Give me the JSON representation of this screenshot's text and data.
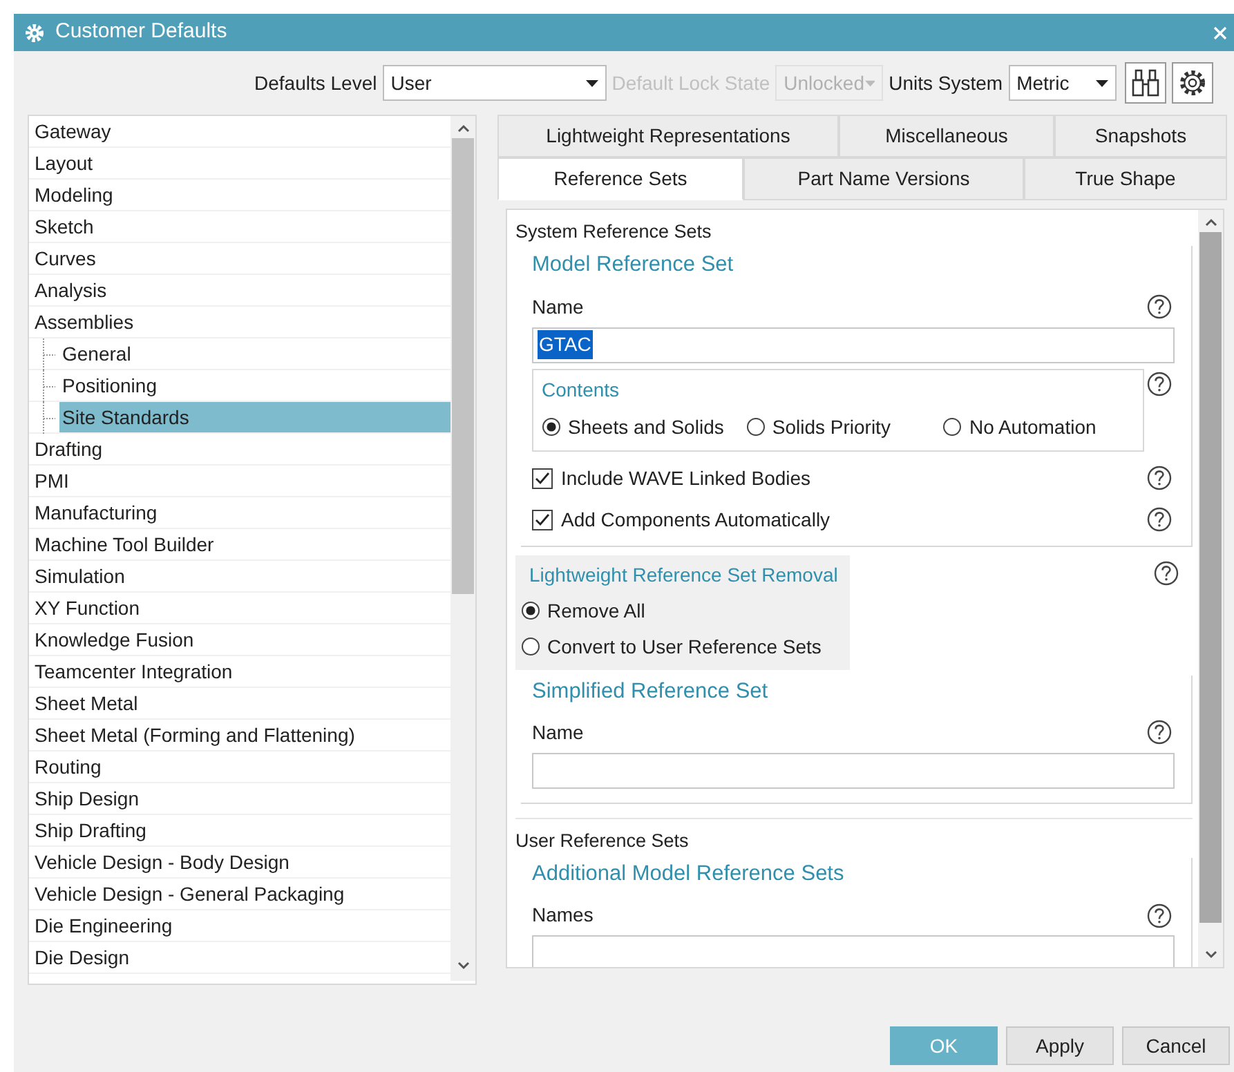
{
  "window": {
    "title": "Customer Defaults"
  },
  "toolbar": {
    "fields": [
      {
        "label": "Defaults Level",
        "value": "User",
        "disabled": false,
        "kind": "wide"
      },
      {
        "label": "Default Lock State",
        "value": "Unlocked",
        "disabled": true,
        "kind": "narrow"
      },
      {
        "label": "Units System",
        "value": "Metric",
        "disabled": false,
        "kind": "narrow"
      }
    ]
  },
  "sidebar": {
    "items": [
      {
        "label": "Gateway",
        "selected": false
      },
      {
        "label": "Layout",
        "selected": false
      },
      {
        "label": "Modeling",
        "selected": false
      },
      {
        "label": "Sketch",
        "selected": false
      },
      {
        "label": "Curves",
        "selected": false
      },
      {
        "label": "Analysis",
        "selected": false
      },
      {
        "label": "Assemblies",
        "selected": false,
        "children": [
          {
            "label": "General",
            "selected": false
          },
          {
            "label": "Positioning",
            "selected": false
          },
          {
            "label": "Site Standards",
            "selected": true
          }
        ]
      },
      {
        "label": "Drafting",
        "selected": false
      },
      {
        "label": "PMI",
        "selected": false
      },
      {
        "label": "Manufacturing",
        "selected": false
      },
      {
        "label": "Machine Tool Builder",
        "selected": false
      },
      {
        "label": "Simulation",
        "selected": false
      },
      {
        "label": "XY Function",
        "selected": false
      },
      {
        "label": "Knowledge Fusion",
        "selected": false
      },
      {
        "label": "Teamcenter Integration",
        "selected": false
      },
      {
        "label": "Sheet Metal",
        "selected": false
      },
      {
        "label": "Sheet Metal (Forming and Flattening)",
        "selected": false
      },
      {
        "label": "Routing",
        "selected": false
      },
      {
        "label": "Ship Design",
        "selected": false
      },
      {
        "label": "Ship Drafting",
        "selected": false
      },
      {
        "label": "Vehicle Design - Body Design",
        "selected": false
      },
      {
        "label": "Vehicle Design - General Packaging",
        "selected": false
      },
      {
        "label": "Die Engineering",
        "selected": false
      },
      {
        "label": "Die Design",
        "selected": false
      }
    ]
  },
  "tabs": [
    [
      {
        "label": "Lightweight Representations",
        "selected": false
      },
      {
        "label": "Miscellaneous",
        "selected": false
      },
      {
        "label": "Snapshots",
        "selected": false
      }
    ],
    [
      {
        "label": "Reference Sets",
        "selected": true
      },
      {
        "label": "Part Name Versions",
        "selected": false
      },
      {
        "label": "True Shape",
        "selected": false
      }
    ]
  ],
  "system_group": {
    "title": "System Reference Sets",
    "model_set": {
      "title": "Model Reference Set",
      "name_label": "Name",
      "name_value": "GTAC",
      "value_highlighted": true,
      "contents": {
        "title": "Contents",
        "options": [
          {
            "label": "Sheets and Solids",
            "selected": true
          },
          {
            "label": "Solids Priority",
            "selected": false
          },
          {
            "label": "No Automation",
            "selected": false
          }
        ]
      },
      "checkboxes": [
        {
          "label": "Include WAVE Linked Bodies",
          "checked": true
        },
        {
          "label": "Add Components Automatically",
          "checked": true
        }
      ]
    },
    "removal": {
      "title": "Lightweight Reference Set Removal",
      "options": [
        {
          "label": "Remove All",
          "selected": true
        },
        {
          "label": "Convert to User Reference Sets",
          "selected": false
        }
      ]
    },
    "simplified_set": {
      "title": "Simplified Reference Set",
      "name_label": "Name"
    }
  },
  "user_group": {
    "title": "User Reference Sets",
    "additional": {
      "title": "Additional Model Reference Sets",
      "names_label": "Names"
    }
  },
  "buttons": [
    {
      "label": "OK",
      "kind": "primary"
    },
    {
      "label": "Apply",
      "kind": "normal"
    },
    {
      "label": "Cancel",
      "kind": "normal"
    }
  ]
}
